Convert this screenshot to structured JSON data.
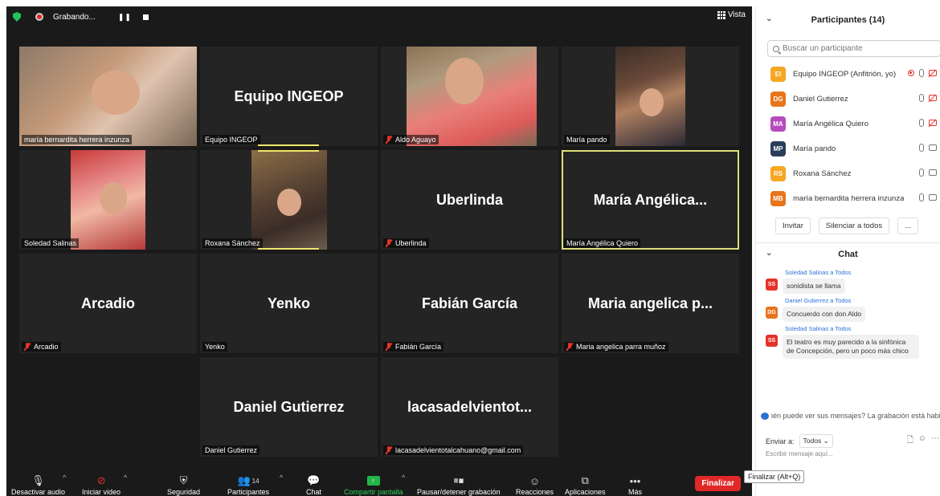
{
  "recording": {
    "label": "Grabando...",
    "pause": "❚❚"
  },
  "view_label": "Vista",
  "tiles": [
    {
      "name": "maría bernardita herrera inzunza",
      "big": "",
      "muted": false,
      "photo": "ph-warm"
    },
    {
      "name": "Equipo INGEOP",
      "big": "Equipo INGEOP",
      "muted": false,
      "photo": ""
    },
    {
      "name": "Aldo Aguayo",
      "big": "",
      "muted": true,
      "photo": "ph-red"
    },
    {
      "name": "María pando",
      "big": "",
      "muted": false,
      "photo": "ph-dark"
    },
    {
      "name": "Soledad Salinas",
      "big": "",
      "muted": false,
      "photo": "ph-pink"
    },
    {
      "name": "Roxana Sánchez",
      "big": "",
      "muted": false,
      "photo": "ph-brown"
    },
    {
      "name": "Uberlinda",
      "big": "Uberlinda",
      "muted": true,
      "photo": ""
    },
    {
      "name": "María Angélica Quiero",
      "big": "María  Angélica...",
      "muted": false,
      "photo": ""
    },
    {
      "name": "Arcadio",
      "big": "Arcadio",
      "muted": true,
      "photo": ""
    },
    {
      "name": "Yenko",
      "big": "Yenko",
      "muted": false,
      "photo": ""
    },
    {
      "name": "Fabián García",
      "big": "Fabián García",
      "muted": true,
      "photo": ""
    },
    {
      "name": "Maria angelica parra muñoz",
      "big": "Maria angelica p...",
      "muted": true,
      "photo": ""
    },
    {
      "name": "Daniel Gutierrez",
      "big": "Daniel Gutierrez",
      "muted": false,
      "photo": ""
    },
    {
      "name": "lacasadelvientotalcahuano@gmail.com",
      "big": "lacasadelvientot...",
      "muted": true,
      "photo": ""
    }
  ],
  "toolbar": {
    "audio": "Desactivar audio",
    "video": "Iniciar video",
    "security": "Seguridad",
    "participants": "Participantes",
    "participants_count": "14",
    "chat": "Chat",
    "share": "Compartir pantalla",
    "record": "Pausar/detener grabación",
    "reactions": "Reacciones",
    "apps": "Aplicaciones",
    "more": "Más",
    "end": "Finalizar",
    "end_tooltip": "Finalizar (Alt+Q)"
  },
  "participants_panel": {
    "title": "Participantes (14)",
    "search_placeholder": "Buscar un participante",
    "list": [
      {
        "initials": "EI",
        "name": "Equipo INGEOP (Anfitrión, yo)",
        "color": "#f5a623",
        "recording": true,
        "cam_off": true
      },
      {
        "initials": "DG",
        "name": "Daniel Gutierrez",
        "color": "#e8741c",
        "recording": false,
        "cam_off": true
      },
      {
        "initials": "MA",
        "name": "María Angélica Quiero",
        "color": "#b54bbd",
        "recording": false,
        "cam_off": true
      },
      {
        "initials": "MP",
        "name": "María pando",
        "color": "#2a3e5a",
        "recording": false,
        "cam_off": false
      },
      {
        "initials": "RS",
        "name": "Roxana Sánchez",
        "color": "#f5a623",
        "recording": false,
        "cam_off": false
      },
      {
        "initials": "MB",
        "name": "maría bernardita herrera inzunza",
        "color": "#e8741c",
        "recording": false,
        "cam_off": false
      }
    ],
    "invite": "Invitar",
    "mute_all": "Silenciar a todos",
    "more": "..."
  },
  "chat_panel": {
    "title": "Chat",
    "messages": [
      {
        "header": "Soledad Salinas a Todos",
        "initials": "SS",
        "color": "#e5332a",
        "text": "sonidista se llama"
      },
      {
        "header": "Daniel Gutierrez a Todos",
        "initials": "DG",
        "color": "#e8741c",
        "text": "Concuerdo con don Aldo"
      },
      {
        "header": "Soledad Salinas a Todos",
        "initials": "SS",
        "color": "#e5332a",
        "text": "El teatro es muy parecido a la sinfónica de Concepción, pero un poco más chico"
      }
    ],
    "notice": "ién puede ver sus mensajes? La grabación está habi",
    "send_to_label": "Enviar a:",
    "send_to_value": "Todos",
    "input_placeholder": "Escribir mensaje aquí..."
  }
}
